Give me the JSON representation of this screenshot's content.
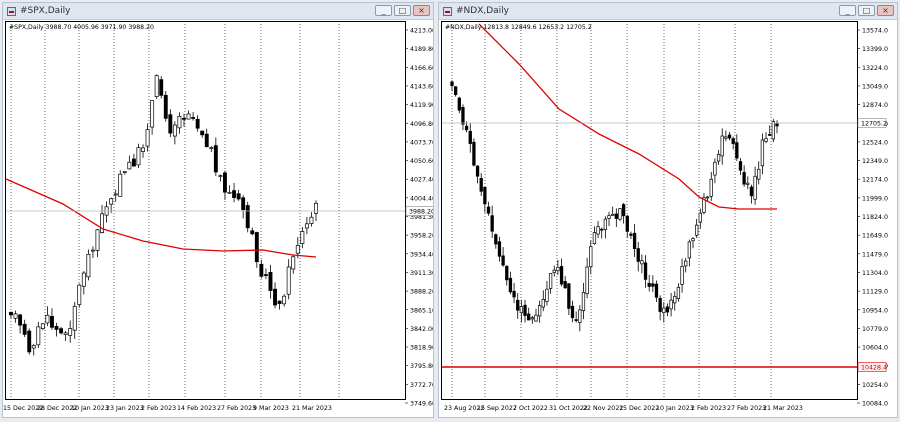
{
  "windows": [
    {
      "title": "#SPX,Daily",
      "header_text": "#SPX,Daily  3988.70 4005.96 3971.90 3988.20",
      "price_marker": "3988.20",
      "y_labels": [
        "4213.00",
        "4189.80",
        "4166.60",
        "4143.60",
        "4119.90",
        "4096.80",
        "4073.70",
        "4050.60",
        "4027.40",
        "4004.40",
        "3981.30",
        "3958.20",
        "3934.40",
        "3911.30",
        "3888.20",
        "3865.10",
        "3842.00",
        "3818.90",
        "3795.80",
        "3772.70",
        "3749.60"
      ],
      "x_labels": [
        "15 Dec 2022",
        "28 Dec 2022",
        "10 Jan 2023",
        "23 Jan 2023",
        "2 Feb 2023",
        "14 Feb 2023",
        "27 Feb 2023",
        "9 Mar 2023",
        "21 Mar 2023"
      ],
      "buttons": {
        "minimize": "_",
        "maximize": "□",
        "close": "×"
      }
    },
    {
      "title": "#NDX,Daily",
      "header_text": "#NDX,Daily  12813.8 12849.6 12653.2 12705.2",
      "price_marker": "12705.2",
      "line_marker": "10428.4",
      "y_labels": [
        "13574.0",
        "13399.0",
        "13224.0",
        "13049.0",
        "12874.0",
        "12699.0",
        "12524.0",
        "12349.0",
        "12174.0",
        "11999.0",
        "11824.0",
        "11649.0",
        "11479.0",
        "11304.0",
        "11129.0",
        "10954.0",
        "10779.0",
        "10604.0",
        "10429.0",
        "10254.0",
        "10084.0"
      ],
      "x_labels": [
        "23 Aug 2022",
        "15 Sep 2022",
        "7 Oct 2022",
        "31 Oct 2022",
        "22 Nov 2022",
        "15 Dec 2022",
        "10 Jan 2023",
        "2 Feb 2023",
        "27 Feb 2023",
        "21 Mar 2023"
      ],
      "buttons": {
        "minimize": "_",
        "maximize": "□",
        "close": "×"
      }
    }
  ],
  "colors": {
    "ma_line": "#e00000",
    "candle_up": "#ffffff",
    "candle_down": "#000000",
    "grid_line": "#000000",
    "price_line": "#b8b8b8"
  }
}
